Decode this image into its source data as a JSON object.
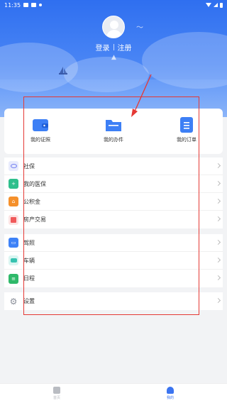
{
  "status_bar": {
    "time": "11:35"
  },
  "header": {
    "login": "登录",
    "register": "注册"
  },
  "quick_actions": [
    {
      "label": "我的证照",
      "icon": "wallet-icon"
    },
    {
      "label": "我的办件",
      "icon": "folder-icon"
    },
    {
      "label": "我的订单",
      "icon": "order-list-icon"
    }
  ],
  "groups": [
    {
      "items": [
        {
          "label": "社保",
          "icon": "social-security-icon",
          "color": "#6f7cf0"
        },
        {
          "label": "我的医保",
          "icon": "medical-insurance-icon",
          "color": "#2fbf8c"
        },
        {
          "label": "公积金",
          "icon": "housing-fund-icon",
          "color": "#f5902b"
        },
        {
          "label": "房产交易",
          "icon": "property-icon",
          "color": "#f0595a"
        }
      ]
    },
    {
      "items": [
        {
          "label": "驾照",
          "icon": "driver-license-icon",
          "color": "#3e82f7"
        },
        {
          "label": "车辆",
          "icon": "vehicle-icon",
          "color": "#36c3b0"
        },
        {
          "label": "日程",
          "icon": "calendar-icon",
          "color": "#2fb96a"
        }
      ]
    },
    {
      "items": [
        {
          "label": "设置",
          "icon": "gear-icon",
          "color": "#8a8f99"
        }
      ]
    }
  ],
  "tabbar": [
    {
      "label": "首页",
      "icon": "home-icon",
      "active": false
    },
    {
      "label": "我的",
      "icon": "profile-icon",
      "active": true
    }
  ],
  "colors": {
    "accent": "#2f6ff0",
    "annotation": "#e53935",
    "tab_active": "#3b74f0",
    "tab_inactive": "#b9bcc2"
  }
}
